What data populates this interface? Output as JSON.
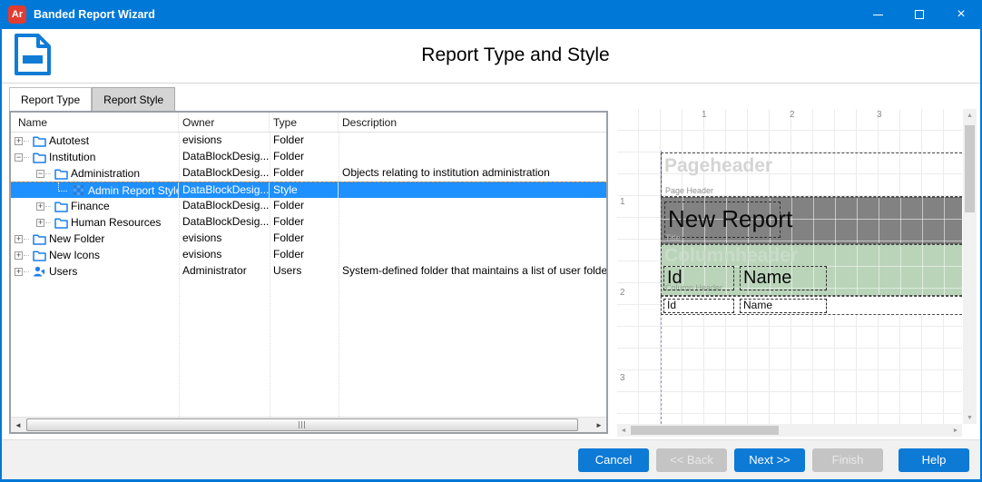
{
  "window": {
    "title": "Banded Report Wizard",
    "app_icon_text": "Ar"
  },
  "header": {
    "title": "Report Type and Style"
  },
  "tabs": [
    {
      "label": "Report Type",
      "active": false
    },
    {
      "label": "Report Style",
      "active": true
    }
  ],
  "tree": {
    "columns": [
      "Name",
      "Owner",
      "Type",
      "Description"
    ],
    "rows": [
      {
        "name": "Autotest",
        "owner": "evisions",
        "type": "Folder",
        "description": "",
        "level": 0,
        "expander": "+",
        "icon": "folder",
        "selected": false
      },
      {
        "name": "Institution",
        "owner": "DataBlockDesig...",
        "type": "Folder",
        "description": "",
        "level": 0,
        "expander": "-",
        "icon": "folder",
        "selected": false
      },
      {
        "name": "Administration",
        "owner": "DataBlockDesig...",
        "type": "Folder",
        "description": "Objects relating to institution administration",
        "level": 1,
        "expander": "-",
        "icon": "folder",
        "selected": false
      },
      {
        "name": "Admin Report Style",
        "owner": "DataBlockDesig...",
        "type": "Style",
        "description": "",
        "level": 2,
        "expander": "",
        "icon": "style",
        "selected": true
      },
      {
        "name": "Finance",
        "owner": "DataBlockDesig...",
        "type": "Folder",
        "description": "",
        "level": 1,
        "expander": "+",
        "icon": "folder",
        "selected": false
      },
      {
        "name": "Human Resources",
        "owner": "DataBlockDesig...",
        "type": "Folder",
        "description": "",
        "level": 1,
        "expander": "+",
        "icon": "folder",
        "selected": false
      },
      {
        "name": "New Folder",
        "owner": "evisions",
        "type": "Folder",
        "description": "",
        "level": 0,
        "expander": "+",
        "icon": "folder",
        "selected": false
      },
      {
        "name": "New Icons",
        "owner": "evisions",
        "type": "Folder",
        "description": "",
        "level": 0,
        "expander": "+",
        "icon": "folder",
        "selected": false
      },
      {
        "name": "Users",
        "owner": "Administrator",
        "type": "Users",
        "description": "System-defined folder that maintains a list of user folders",
        "level": 0,
        "expander": "+",
        "icon": "users",
        "selected": false
      }
    ]
  },
  "preview": {
    "h_ruler": [
      "1",
      "2",
      "3"
    ],
    "v_ruler": [
      "1",
      "2",
      "3"
    ],
    "pageheader": {
      "watermark": "Pageheader",
      "label": "Page Header"
    },
    "title_band": {
      "text": "New Report",
      "label": "Title"
    },
    "columnheader": {
      "watermark": "Columnheader",
      "label": "Column Header",
      "fields": [
        "Id",
        "Name"
      ]
    },
    "detail": {
      "fields": [
        "Id",
        "Name"
      ]
    }
  },
  "buttons": [
    {
      "label": "Cancel",
      "enabled": true
    },
    {
      "label": "<< Back",
      "enabled": false
    },
    {
      "label": "Next >>",
      "enabled": true
    },
    {
      "label": "Finish",
      "enabled": false
    },
    {
      "label": "Help",
      "enabled": true
    }
  ],
  "colors": {
    "accent": "#0078d7",
    "app_icon_bg": "#e03c31",
    "selection": "#1e90ff",
    "band_dark": "#828282",
    "band_green": "#bad4ba",
    "button_blue": "#0d7ad6",
    "button_disabled": "#c4c4c4"
  }
}
